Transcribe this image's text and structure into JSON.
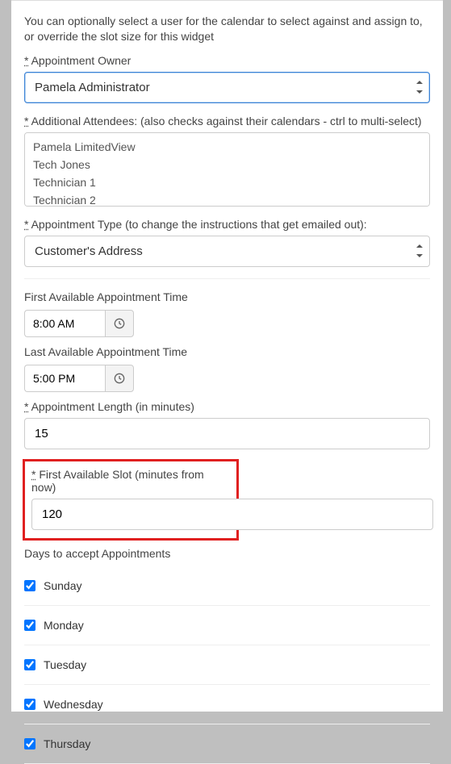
{
  "intro": "You can optionally select a user for the calendar to select against and assign to, or override the slot size for this widget",
  "owner": {
    "label": "Appointment Owner",
    "value": "Pamela Administrator"
  },
  "attendees": {
    "label": "Additional Attendees: (also checks against their calendars - ctrl to multi-select)",
    "items": [
      "Pamela LimitedView",
      "Tech Jones",
      "Technician 1",
      "Technician 2"
    ]
  },
  "appt_type": {
    "label": "Appointment Type (to change the instructions that get emailed out):",
    "value": "Customer's Address"
  },
  "first_time": {
    "label": "First Available Appointment Time",
    "value": "8:00 AM"
  },
  "last_time": {
    "label": "Last Available Appointment Time",
    "value": "5:00 PM"
  },
  "length": {
    "label": "Appointment Length (in minutes)",
    "value": "15"
  },
  "first_slot": {
    "label": "First Available Slot (minutes from now)",
    "value": "120"
  },
  "days": {
    "label": "Days to accept Appointments",
    "items": [
      {
        "name": "Sunday",
        "checked": true
      },
      {
        "name": "Monday",
        "checked": true
      },
      {
        "name": "Tuesday",
        "checked": true
      },
      {
        "name": "Wednesday",
        "checked": true
      },
      {
        "name": "Thursday",
        "checked": true
      }
    ]
  },
  "asterisk": "*"
}
